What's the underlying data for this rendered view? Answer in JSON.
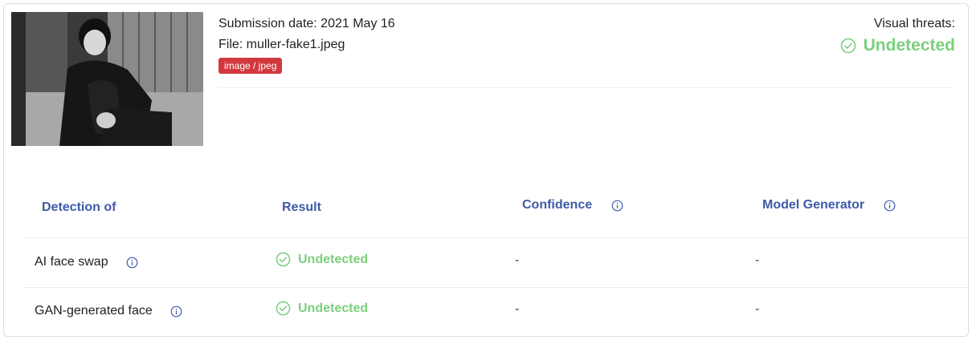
{
  "submission": {
    "date_line": "Submission date: 2021 May 16",
    "file_line": "File: muller-fake1.jpeg",
    "mime_badge": "image / jpeg"
  },
  "threats": {
    "label": "Visual threats:",
    "status": "Undetected",
    "status_color": "#7ccf7c",
    "icon": "check-circle-icon"
  },
  "table": {
    "headers": {
      "detection_of": "Detection of",
      "result": "Result",
      "confidence": "Confidence",
      "model_generator": "Model Generator"
    },
    "rows": [
      {
        "detection": "AI face swap",
        "result": "Undetected",
        "confidence": "-",
        "model_generator": "-"
      },
      {
        "detection": "GAN-generated face",
        "result": "Undetected",
        "confidence": "-",
        "model_generator": "-"
      }
    ]
  },
  "colors": {
    "header_text": "#3f5aa8",
    "badge_bg": "#d2393f",
    "success": "#7ccf7c"
  }
}
